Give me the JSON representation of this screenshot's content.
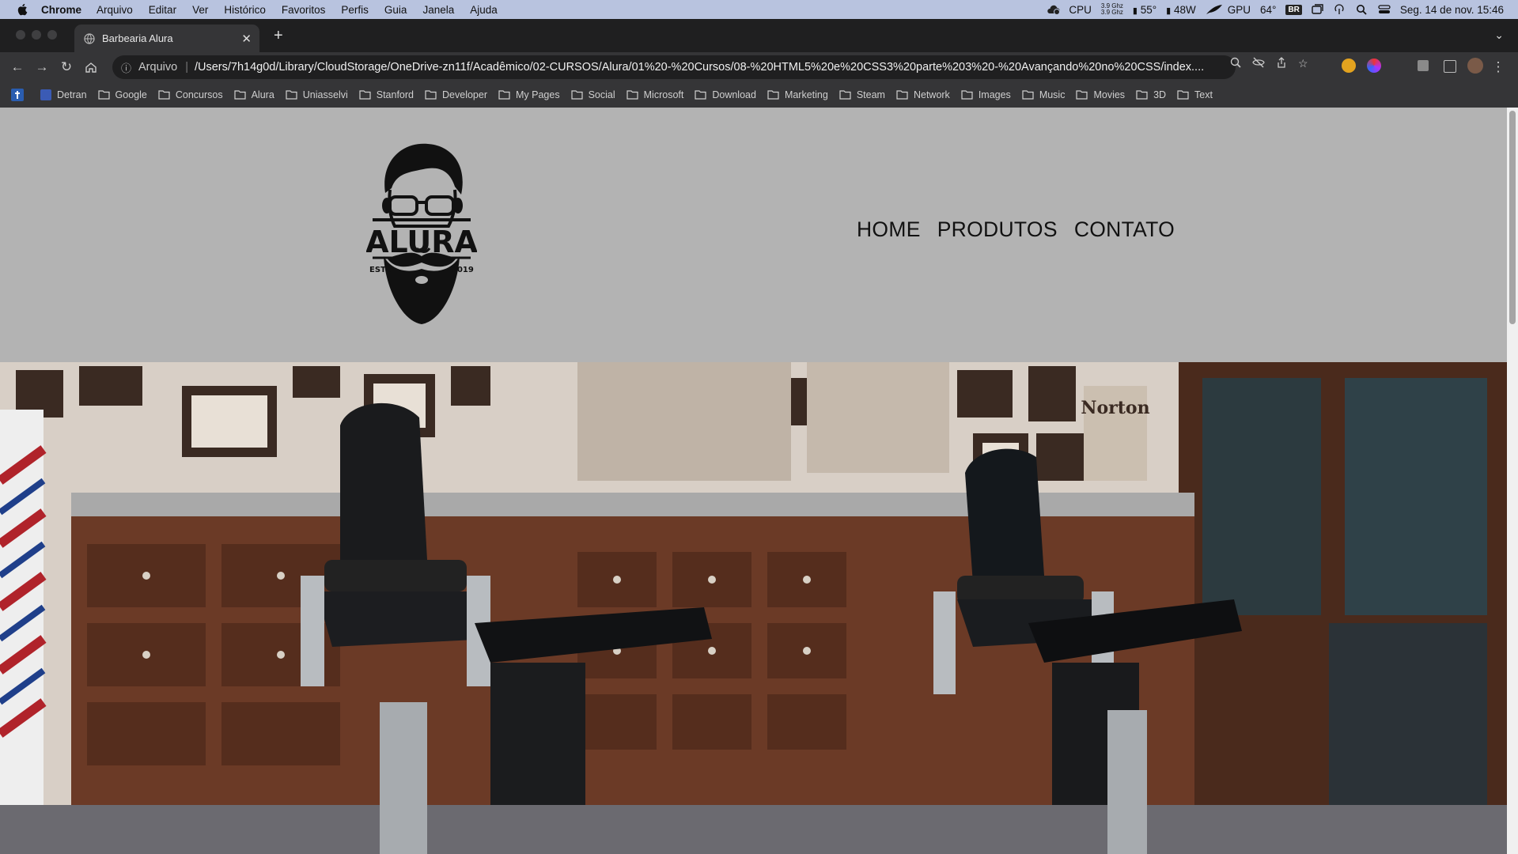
{
  "menubar": {
    "app_name": "Chrome",
    "menus": [
      "Arquivo",
      "Editar",
      "Ver",
      "Histórico",
      "Favoritos",
      "Perfis",
      "Guia",
      "Janela",
      "Ajuda"
    ],
    "cpu_label": "CPU",
    "cpu_freq_1": "3.9 Ghz",
    "cpu_freq_2": "3.9 Ghz",
    "temp_cpu": "55°",
    "power": "48W",
    "gpu_label": "GPU",
    "temp_gpu": "64°",
    "input_source": "BR",
    "datetime": "Seg. 14 de nov.  15:46"
  },
  "browser": {
    "tab_title": "Barbearia Alura",
    "omnibox_scheme": "Arquivo",
    "url": "/Users/7h14g0d/Library/CloudStorage/OneDrive-zn11f/Acadêmico/02-CURSOS/Alura/01%20-%20Cursos/08-%20HTML5%20e%20CSS3%20parte%203%20-%20Avançando%20no%20CSS/index....",
    "bookmarks": [
      "Detran",
      "Google",
      "Concursos",
      "Alura",
      "Uniasselvi",
      "Stanford",
      "Developer",
      "My Pages",
      "Social",
      "Microsoft",
      "Download",
      "Marketing",
      "Steam",
      "Network",
      "Images",
      "Music",
      "Movies",
      "3D",
      "Text"
    ]
  },
  "site": {
    "logo_text": "ALURA",
    "logo_estd": "ESTD",
    "logo_year": "2019",
    "nav": [
      "HOME",
      "PRODUTOS",
      "CONTATO"
    ],
    "hero_sign": "Norton"
  },
  "colors": {
    "page_bg": "#b3b3b3",
    "menubar_bg": "#b8c3df",
    "chrome_dark": "#1f1f20",
    "chrome_toolbar": "#353537"
  }
}
